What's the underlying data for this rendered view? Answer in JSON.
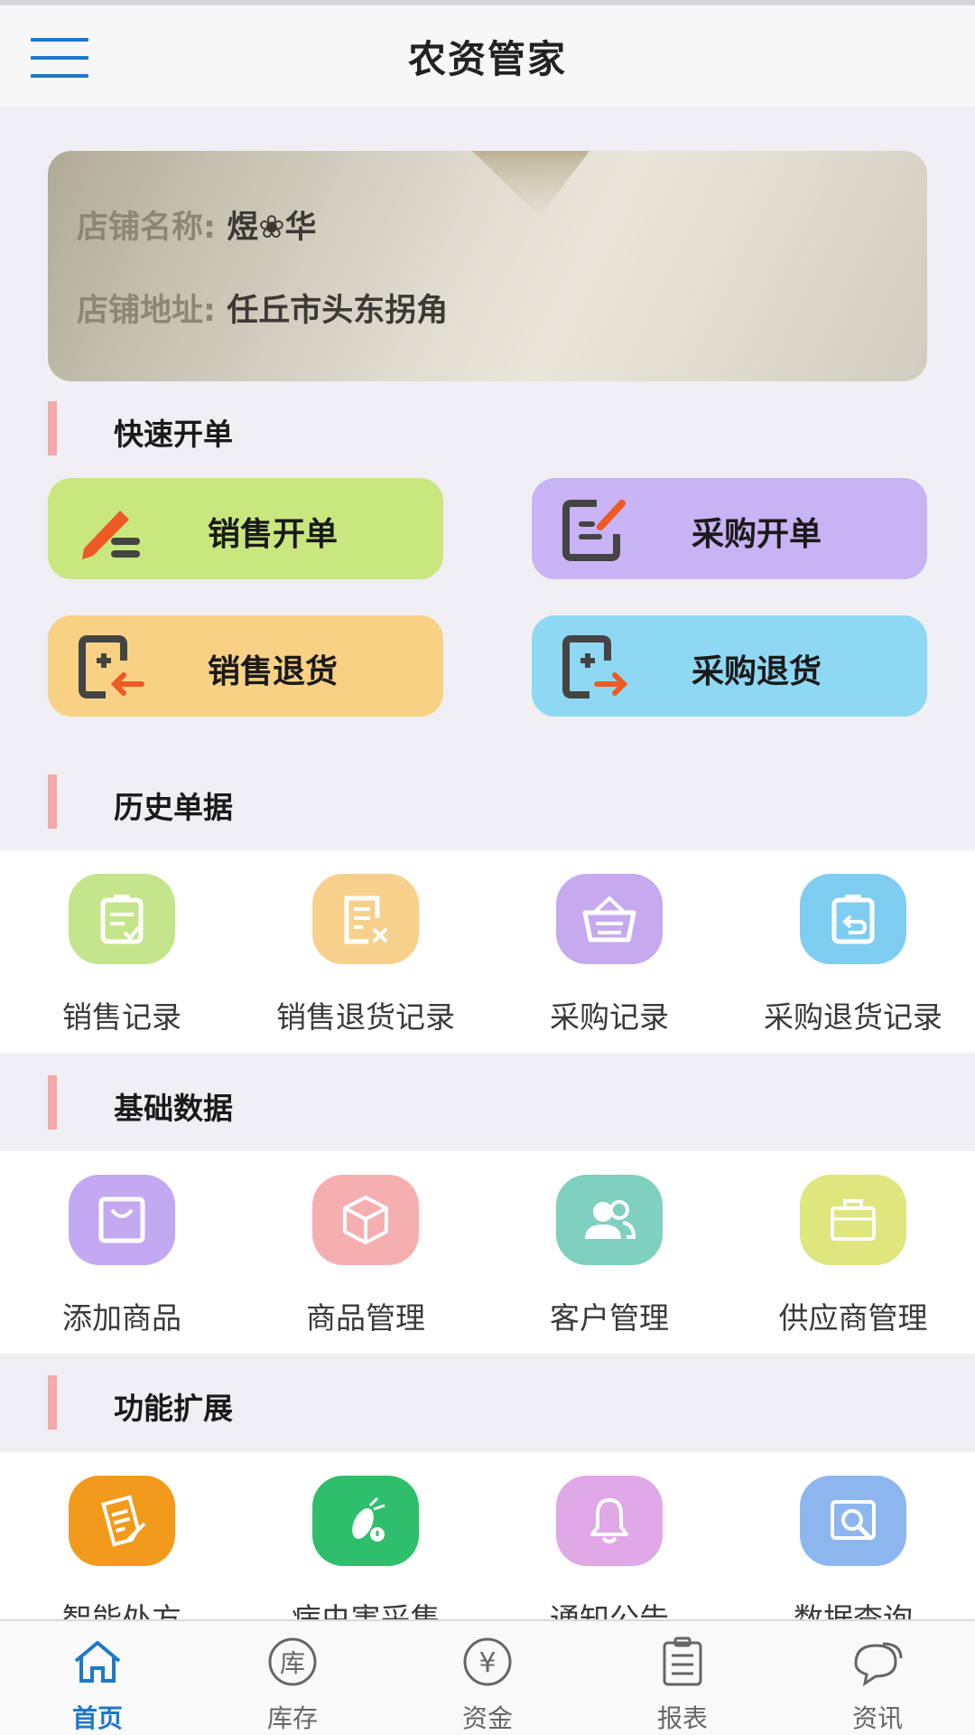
{
  "nav": {
    "title": "农资管家",
    "menu_icon": "menu-icon"
  },
  "store": {
    "name_label": "店铺名称:",
    "name_value": "煜❀华",
    "address_label": "店铺地址:",
    "address_value": "任丘市头东拐角"
  },
  "quick": {
    "title": "快速开单",
    "buttons": [
      {
        "label": "销售开单",
        "icon": "pen-icon",
        "color": "#c8e77f"
      },
      {
        "label": "采购开单",
        "icon": "edit-doc-icon",
        "color": "#c8b3f4"
      },
      {
        "label": "销售退货",
        "icon": "return-in-icon",
        "color": "#f8d185"
      },
      {
        "label": "采购退货",
        "icon": "return-out-icon",
        "color": "#8fd8f3"
      }
    ]
  },
  "history": {
    "title": "历史单据",
    "items": [
      {
        "label": "销售记录",
        "icon": "clipboard-check-icon",
        "color": "#c4e58b"
      },
      {
        "label": "销售退货记录",
        "icon": "doc-cross-icon",
        "color": "#f7d08c"
      },
      {
        "label": "采购记录",
        "icon": "basket-icon",
        "color": "#c7a9f0"
      },
      {
        "label": "采购退货记录",
        "icon": "clipboard-return-icon",
        "color": "#7fcdf1"
      }
    ]
  },
  "basic": {
    "title": "基础数据",
    "items": [
      {
        "label": "添加商品",
        "icon": "bag-icon",
        "color": "#c3a8f2"
      },
      {
        "label": "商品管理",
        "icon": "box-icon",
        "color": "#f6afb1"
      },
      {
        "label": "客户管理",
        "icon": "users-icon",
        "color": "#7fd0bf"
      },
      {
        "label": "供应商管理",
        "icon": "briefcase-icon",
        "color": "#dfe67d"
      }
    ]
  },
  "extend": {
    "title": "功能扩展",
    "items": [
      {
        "label": "智能处方",
        "icon": "prescription-icon",
        "color": "#f29a1b"
      },
      {
        "label": "病虫害采集",
        "icon": "bug-icon",
        "color": "#2fbf6c"
      },
      {
        "label": "通知公告",
        "icon": "bell-icon",
        "color": "#e0a8e6"
      },
      {
        "label": "数据查询",
        "icon": "search-doc-icon",
        "color": "#8db6ee"
      }
    ]
  },
  "tabs": [
    {
      "label": "首页",
      "icon": "home-icon",
      "glyph": "",
      "active": true
    },
    {
      "label": "库存",
      "icon": "inventory-icon",
      "glyph": "库",
      "active": false
    },
    {
      "label": "资金",
      "icon": "yen-icon",
      "glyph": "¥",
      "active": false
    },
    {
      "label": "报表",
      "icon": "report-icon",
      "glyph": "",
      "active": false
    },
    {
      "label": "资讯",
      "icon": "chat-icon",
      "glyph": "",
      "active": false
    }
  ],
  "colors": {
    "accent": "#1e78c8",
    "section_bar": "#f4a9aa",
    "background": "#efeff4"
  }
}
